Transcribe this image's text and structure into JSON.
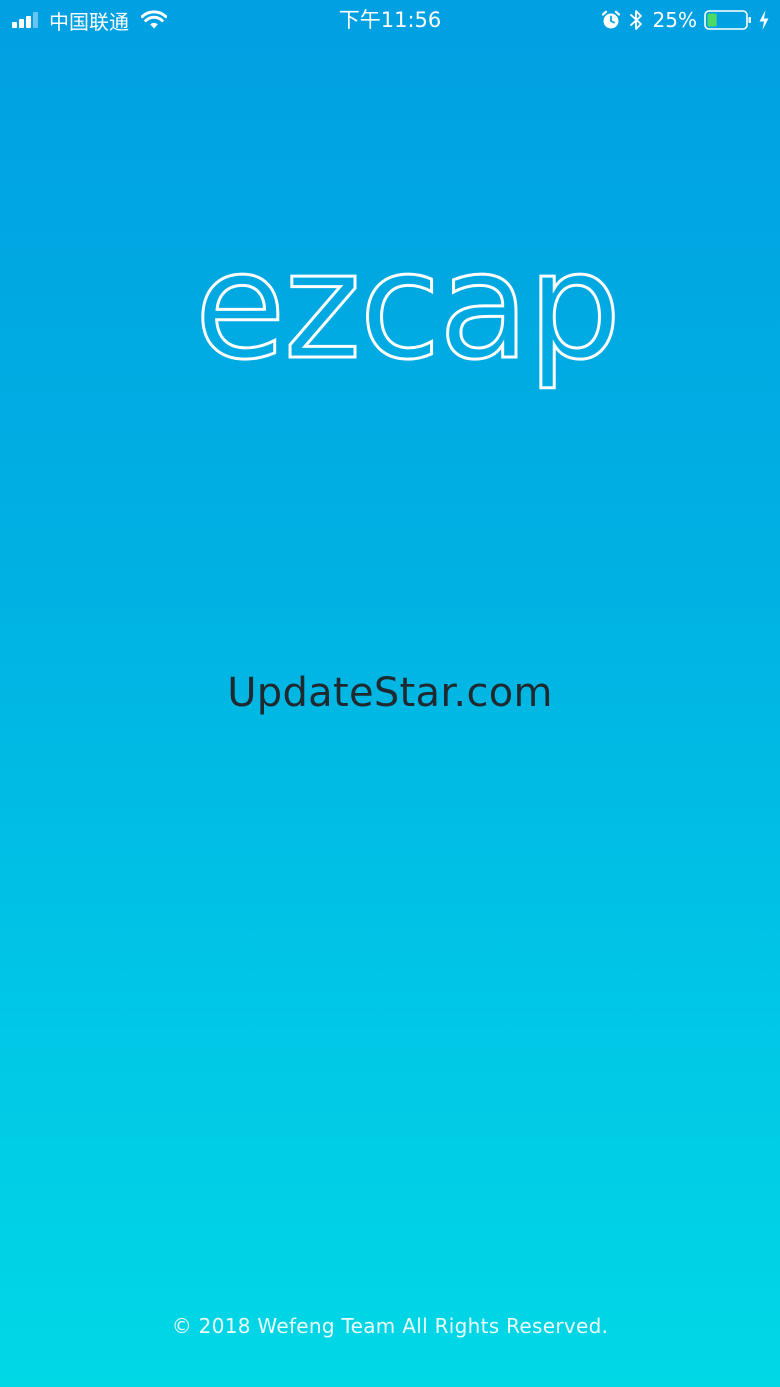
{
  "status_bar": {
    "carrier": "中国联通",
    "time": "下午11:56",
    "battery_percent": "25%",
    "icons": [
      "signal-icon",
      "wifi-icon",
      "alarm-icon",
      "bluetooth-icon",
      "battery-icon",
      "charging-icon"
    ],
    "battery_level": 0.25,
    "battery_fill_color": "#4cd964"
  },
  "logo": {
    "text": "ezcap"
  },
  "watermark": {
    "text": "UpdateStar.com"
  },
  "footer": {
    "copyright": "© 2018 Wefeng Team All Rights Reserved."
  },
  "colors": {
    "gradient_top": "#00a0e2",
    "gradient_bottom": "#00d8e6"
  }
}
